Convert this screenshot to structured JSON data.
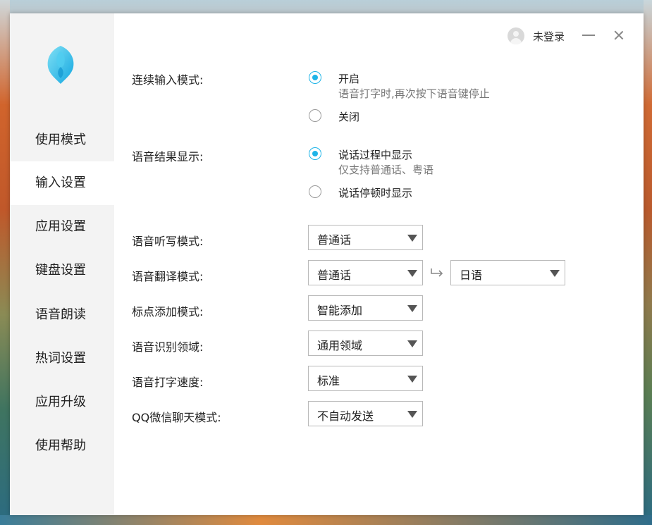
{
  "sidebar": {
    "items": [
      {
        "label": "使用模式"
      },
      {
        "label": "输入设置"
      },
      {
        "label": "应用设置"
      },
      {
        "label": "键盘设置"
      },
      {
        "label": "语音朗读"
      },
      {
        "label": "热词设置"
      },
      {
        "label": "应用升级"
      },
      {
        "label": "使用帮助"
      }
    ],
    "active_index": 1
  },
  "titlebar": {
    "login_label": "未登录",
    "minimize_icon": "minimize-icon",
    "close_icon": "close-icon"
  },
  "settings": {
    "continuous_input": {
      "label": "连续输入模式:",
      "options": [
        {
          "label": "开启",
          "sub": "语音打字时,再次按下语音键停止",
          "checked": true
        },
        {
          "label": "关闭",
          "checked": false
        }
      ]
    },
    "result_display": {
      "label": "语音结果显示:",
      "options": [
        {
          "label": "说话过程中显示",
          "sub": "仅支持普通话、粤语",
          "checked": true
        },
        {
          "label": "说话停顿时显示",
          "checked": false
        }
      ]
    },
    "dictation_mode": {
      "label": "语音听写模式:",
      "value": "普通话"
    },
    "translation_mode": {
      "label": "语音翻译模式:",
      "source": "普通话",
      "target": "日语"
    },
    "punctuation_mode": {
      "label": "标点添加模式:",
      "value": "智能添加"
    },
    "recognition_domain": {
      "label": "语音识别领域:",
      "value": "通用领域"
    },
    "typing_speed": {
      "label": "语音打字速度:",
      "value": "标准"
    },
    "chat_mode": {
      "label": "QQ微信聊天模式:",
      "value": "不自动发送"
    }
  },
  "colors": {
    "accent": "#1eb4e8",
    "sidebar_bg": "#f3f3f3"
  }
}
